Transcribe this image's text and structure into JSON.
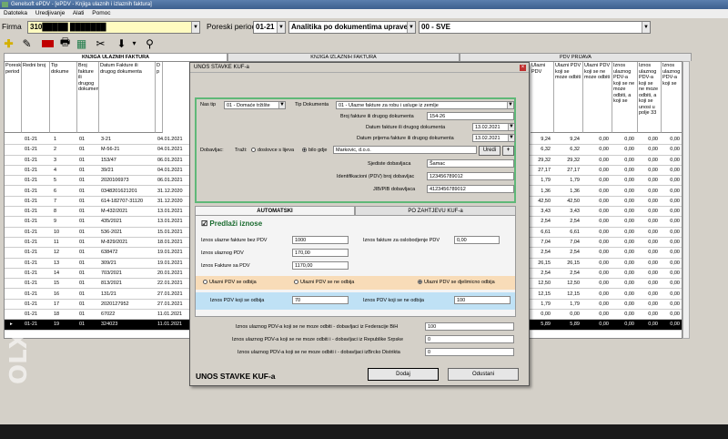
{
  "window": {
    "title": "Genelsoft ePDV - [ePDV - Knjiga ulaznih i izlaznih faktura]"
  },
  "menu": [
    "Datoteka",
    "Uredjivanje",
    "Alati",
    "Pomoc"
  ],
  "firma": {
    "label": "Firma",
    "value": "310█████ ███████"
  },
  "poreski": {
    "label": "Poreski period",
    "value": "01-21",
    "analitika": "Analitika po dokumentima uprave",
    "sve": "00 - SVE"
  },
  "tabs": {
    "ulazne": "KNJIGA ULAZNIH FAKTURA",
    "izlazne": "KNJIGA IZLAZNIH FAKTURA",
    "prijava": "PDV PRIJAVA"
  },
  "grid": {
    "headers": [
      "Poreski period",
      "Redni broj",
      "Tip dokume",
      "Broj fakture ili drugog dokumenta",
      "Datum Fakture ili drugog dokumenta",
      "D p"
    ],
    "right_headers": [
      "Ulazni PDV",
      "Ulazni PDV koji se moze odbiti",
      "Ulazni PDV koji se ne moze odbiti",
      "Iznos ulaznog PDV-a koji se ne moze odbiti, a koji se",
      "Iznos ulaznog PDV-a koji se ne moze odbiti, a koji se unosi u polje 33",
      "Iznos ulaznog PDV-a koji se"
    ],
    "rows": [
      [
        "01-21",
        "1",
        "01",
        "3-21",
        "04.01.2021",
        "9,24",
        "9,24",
        "0,00",
        "0,00",
        "0,00",
        "0,00"
      ],
      [
        "01-21",
        "2",
        "01",
        "M-56-21",
        "04.01.2021",
        "6,32",
        "6,32",
        "0,00",
        "0,00",
        "0,00",
        "0,00"
      ],
      [
        "01-21",
        "3",
        "01",
        "153/47",
        "06.01.2021",
        "29,32",
        "29,32",
        "0,00",
        "0,00",
        "0,00",
        "0,00"
      ],
      [
        "01-21",
        "4",
        "01",
        "39/21",
        "04.01.2021",
        "27,17",
        "27,17",
        "0,00",
        "0,00",
        "0,00",
        "0,00"
      ],
      [
        "01-21",
        "5",
        "01",
        "2020106973",
        "06.01.2021",
        "1,79",
        "1,79",
        "0,00",
        "0,00",
        "0,00",
        "0,00"
      ],
      [
        "01-21",
        "6",
        "01",
        "0348201621201",
        "31.12.2020",
        "1,36",
        "1,36",
        "0,00",
        "0,00",
        "0,00",
        "0,00"
      ],
      [
        "01-21",
        "7",
        "01",
        "614-182707-31120",
        "31.12.2020",
        "42,50",
        "42,50",
        "0,00",
        "0,00",
        "0,00",
        "0,00"
      ],
      [
        "01-21",
        "8",
        "01",
        "M-432/2021",
        "13.01.2021",
        "3,43",
        "3,43",
        "0,00",
        "0,00",
        "0,00",
        "0,00"
      ],
      [
        "01-21",
        "9",
        "01",
        "435/2021",
        "13.01.2021",
        "2,54",
        "2,54",
        "0,00",
        "0,00",
        "0,00",
        "0,00"
      ],
      [
        "01-21",
        "10",
        "01",
        "536-2021",
        "15.01.2021",
        "6,61",
        "6,61",
        "0,00",
        "0,00",
        "0,00",
        "0,00"
      ],
      [
        "01-21",
        "11",
        "01",
        "M-829/2021",
        "18.01.2021",
        "7,04",
        "7,04",
        "0,00",
        "0,00",
        "0,00",
        "0,00"
      ],
      [
        "01-21",
        "12",
        "01",
        "638472",
        "19.01.2021",
        "2,54",
        "2,54",
        "0,00",
        "0,00",
        "0,00",
        "0,00"
      ],
      [
        "01-21",
        "13",
        "01",
        "309/21",
        "19.01.2021",
        "26,15",
        "26,15",
        "0,00",
        "0,00",
        "0,00",
        "0,00"
      ],
      [
        "01-21",
        "14",
        "01",
        "703/2021",
        "20.01.2021",
        "2,54",
        "2,54",
        "0,00",
        "0,00",
        "0,00",
        "0,00"
      ],
      [
        "01-21",
        "15",
        "01",
        "813/2021",
        "22.01.2021",
        "12,50",
        "12,50",
        "0,00",
        "0,00",
        "0,00",
        "0,00"
      ],
      [
        "01-21",
        "16",
        "01",
        "131/21",
        "27.01.2021",
        "12,15",
        "12,15",
        "0,00",
        "0,00",
        "0,00",
        "0,00"
      ],
      [
        "01-21",
        "17",
        "01",
        "2020127952",
        "27.01.2021",
        "1,79",
        "1,79",
        "0,00",
        "0,00",
        "0,00",
        "0,00"
      ],
      [
        "01-21",
        "18",
        "01",
        "67022",
        "11.01.2021",
        "0,00",
        "0,00",
        "0,00",
        "0,00",
        "0,00",
        "0,00"
      ],
      [
        "01-21",
        "19",
        "01",
        "324023",
        "11.01.2021",
        "5,89",
        "5,89",
        "0,00",
        "0,00",
        "0,00",
        "0,00"
      ]
    ]
  },
  "dialog": {
    "title": "UNOS STAVKE KUF-a",
    "nas_tip_label": "Nas tip",
    "nas_tip": "01 - Domaće tržište",
    "tip_dok_label": "Tip Dokumenta",
    "tip_dok": "01 - Ulazne fakture za robu i usluge iz zemlje",
    "broj_label": "Broj fakture ili drugog dokumenta",
    "broj": "154-26",
    "datum_label": "Datum fakture ili drugog dokumenta",
    "datum": "13.02.2021",
    "datum_prijema_label": "Datum prijema fakture ili drugog dokumenta",
    "datum_prijema": "13.02.2021",
    "dobavljac_label": "Dobavljac:",
    "trazi_label": "Traži:",
    "dosl_label": "doslovce s lijeva",
    "bilo_label": "bilo gdje",
    "dobavljac": "Markovic, d.o.o.",
    "uredi": "Uredi",
    "plus": "+",
    "sjediste_label": "Sjediste dobavljaca",
    "sjediste": "Šamac",
    "ident_label": "Identifikacioni (PDV) broj dobavljac",
    "ident": "123456789012",
    "jib_label": "JIB/PIB dobavljaca",
    "jib": "4123456789012",
    "tab_auto": "AUTOMATSKI",
    "tab_zahtjev": "PO ZAHTJEVU KUF-a",
    "predlazi": "Predlaži iznose",
    "bez_pdv_label": "Iznos ulazne fakture bez PDV",
    "bez_pdv": "1000",
    "osl_label": "Iznos fakture za oslobodjenje PDV",
    "osl": "0,00",
    "ulazni_label": "Iznos ulaznog PDV",
    "ulazni": "170,00",
    "sa_pdv_label": "Iznos Fakture sa PDV",
    "sa_pdv": "1170,00",
    "r_odbija": "Ulazni PDV se odbija",
    "r_ne": "Ulazni PDV se ne odbija",
    "r_djel": "Ulazni PDV se djelimicno odbija",
    "koji_label": "Iznos PDV koji se odbija",
    "koji": "70",
    "ne_label": "Iznos PDV koji se ne odbija",
    "ne": "100",
    "fbih_label": "Iznos ulaznog PDV-a koji se ne moze odbiti - dobavljaci iz Federacije BiH",
    "fbih": "100",
    "rs_label": "Iznos ulaznog PDV-a koji se ne moze odbiti i - dobavljaci iz Republike Srpske",
    "rs": "0",
    "bd_label": "Iznos ulaznog PDV-a koji se ne moze odbiti i - dobavljaci izBrcko Distrikta",
    "bd": "0",
    "footer": "UNOS STAVKE KUF-a",
    "dodaj": "Dodaj",
    "odustani": "Odustani"
  },
  "watermark": "OLX"
}
